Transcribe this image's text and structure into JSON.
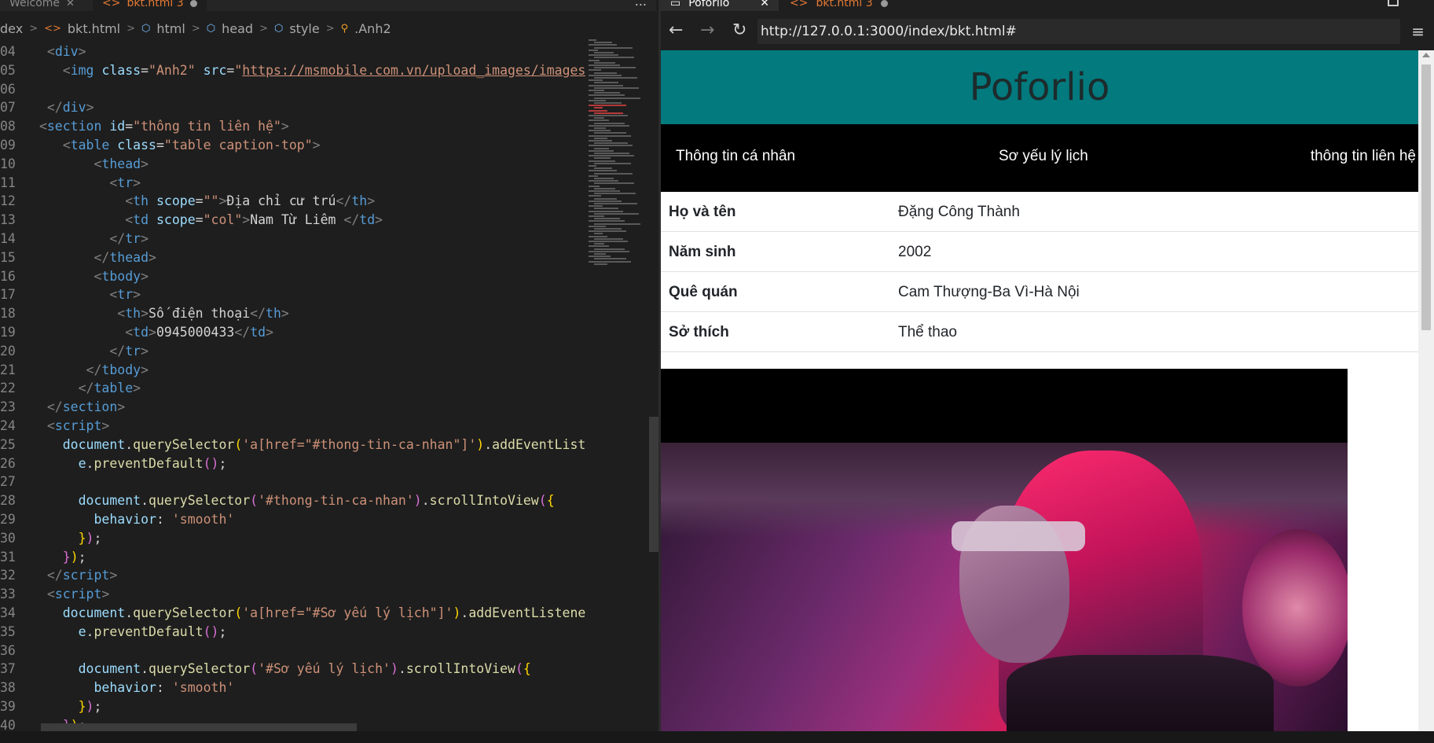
{
  "editor": {
    "tabs": [
      {
        "label": "Welcome",
        "active": false
      },
      {
        "label": "bkt.html 3",
        "active": true
      }
    ],
    "more_label": "...",
    "breadcrumb": [
      "dex",
      "bkt.html",
      "html",
      "head",
      "style",
      ".Anh2"
    ]
  },
  "code_lines": [
    {
      "n": "04",
      "html": "  <span class='t-br'>&lt;</span><span class='t-tag'>div</span><span class='t-br'>&gt;</span>"
    },
    {
      "n": "05",
      "html": "    <span class='t-br'>&lt;</span><span class='t-tag'>img</span> <span class='t-attr'>class</span>=<span class='t-str'>\"Anh2\"</span> <span class='t-attr'>src</span>=<span class='t-str'>\"</span><span class='t-url'>https://msmobile.com.vn/upload_images/images/</span>"
    },
    {
      "n": "06",
      "html": ""
    },
    {
      "n": "07",
      "html": "  <span class='t-br'>&lt;/</span><span class='t-tag'>div</span><span class='t-br'>&gt;</span>"
    },
    {
      "n": "08",
      "html": " <span class='t-br'>&lt;</span><span class='t-tag'>section</span> <span class='t-attr'>id</span>=<span class='t-str'>\"thông tin liên hệ\"</span><span class='t-br'>&gt;</span>"
    },
    {
      "n": "09",
      "html": "    <span class='t-br'>&lt;</span><span class='t-tag'>table</span> <span class='t-attr'>class</span>=<span class='t-str'>\"table caption-top\"</span><span class='t-br'>&gt;</span>"
    },
    {
      "n": "10",
      "html": "        <span class='t-br'>&lt;</span><span class='t-tag'>thead</span><span class='t-br'>&gt;</span>"
    },
    {
      "n": "11",
      "html": "          <span class='t-br'>&lt;</span><span class='t-tag'>tr</span><span class='t-br'>&gt;</span>"
    },
    {
      "n": "12",
      "html": "            <span class='t-br'>&lt;</span><span class='t-tag'>th</span> <span class='t-attr'>scope</span>=<span class='t-str'>\"\"</span><span class='t-br'>&gt;</span><span class='t-txt'>Địa chỉ cư trú</span><span class='t-br'>&lt;/</span><span class='t-tag'>th</span><span class='t-br'>&gt;</span>"
    },
    {
      "n": "13",
      "html": "            <span class='t-br'>&lt;</span><span class='t-tag'>td</span> <span class='t-attr'>scope</span>=<span class='t-str'>\"col\"</span><span class='t-br'>&gt;</span><span class='t-txt'>Nam Từ Liêm </span><span class='t-br'>&lt;/</span><span class='t-tag'>td</span><span class='t-br'>&gt;</span>"
    },
    {
      "n": "14",
      "html": "          <span class='t-br'>&lt;/</span><span class='t-tag'>tr</span><span class='t-br'>&gt;</span>"
    },
    {
      "n": "15",
      "html": "        <span class='t-br'>&lt;/</span><span class='t-tag'>thead</span><span class='t-br'>&gt;</span>"
    },
    {
      "n": "16",
      "html": "        <span class='t-br'>&lt;</span><span class='t-tag'>tbody</span><span class='t-br'>&gt;</span>"
    },
    {
      "n": "17",
      "html": "          <span class='t-br'>&lt;</span><span class='t-tag'>tr</span><span class='t-br'>&gt;</span>"
    },
    {
      "n": "18",
      "html": "           <span class='t-br'>&lt;</span><span class='t-tag'>th</span><span class='t-br'>&gt;</span><span class='t-txt'>Số điện thoại</span><span class='t-br'>&lt;/</span><span class='t-tag'>th</span><span class='t-br'>&gt;</span>"
    },
    {
      "n": "19",
      "html": "            <span class='t-br'>&lt;</span><span class='t-tag'>td</span><span class='t-br'>&gt;</span><span class='t-txt'>0945000433</span><span class='t-br'>&lt;/</span><span class='t-tag'>td</span><span class='t-br'>&gt;</span>"
    },
    {
      "n": "20",
      "html": "          <span class='t-br'>&lt;/</span><span class='t-tag'>tr</span><span class='t-br'>&gt;</span>"
    },
    {
      "n": "21",
      "html": "       <span class='t-br'>&lt;/</span><span class='t-tag'>tbody</span><span class='t-br'>&gt;</span>"
    },
    {
      "n": "22",
      "html": "      <span class='t-br'>&lt;/</span><span class='t-tag'>table</span><span class='t-br'>&gt;</span>"
    },
    {
      "n": "23",
      "html": "  <span class='t-br'>&lt;/</span><span class='t-tag'>section</span><span class='t-br'>&gt;</span>"
    },
    {
      "n": "24",
      "html": "  <span class='t-br'>&lt;</span><span class='t-tag'>script</span><span class='t-br'>&gt;</span>"
    },
    {
      "n": "25",
      "html": "    <span class='t-var'>document</span>.<span class='t-fn'>querySelector</span><span class='t-y'>(</span><span class='t-str'>'a[href=\"#thong-tin-ca-nhan\"]'</span><span class='t-y'>)</span>.<span class='t-fn'>addEventListe</span>"
    },
    {
      "n": "26",
      "html": "      <span class='t-var'>e</span>.<span class='t-fn'>preventDefault</span><span class='t-p'>()</span>;"
    },
    {
      "n": "27",
      "html": ""
    },
    {
      "n": "28",
      "html": "      <span class='t-var'>document</span>.<span class='t-fn'>querySelector</span><span class='t-p'>(</span><span class='t-str'>'#thong-tin-ca-nhan'</span><span class='t-p'>)</span>.<span class='t-fn'>scrollIntoView</span><span class='t-p'>(</span><span class='t-y'>{</span>"
    },
    {
      "n": "29",
      "html": "        <span class='t-var'>behavior</span>: <span class='t-str'>'smooth'</span>"
    },
    {
      "n": "30",
      "html": "      <span class='t-y'>}</span><span class='t-p'>)</span>;"
    },
    {
      "n": "31",
      "html": "    <span class='t-p'>}</span><span class='t-y'>)</span>;"
    },
    {
      "n": "32",
      "html": "  <span class='t-br'>&lt;/</span><span class='t-tag'>script</span><span class='t-br'>&gt;</span>"
    },
    {
      "n": "33",
      "html": "  <span class='t-br'>&lt;</span><span class='t-tag'>script</span><span class='t-br'>&gt;</span>"
    },
    {
      "n": "34",
      "html": "    <span class='t-var'>document</span>.<span class='t-fn'>querySelector</span><span class='t-y'>(</span><span class='t-str'>'a[href=\"#Sơ yếu lý lịch\"]'</span><span class='t-y'>)</span>.<span class='t-fn'>addEventListener</span>"
    },
    {
      "n": "35",
      "html": "      <span class='t-var'>e</span>.<span class='t-fn'>preventDefault</span><span class='t-p'>()</span>;"
    },
    {
      "n": "36",
      "html": ""
    },
    {
      "n": "37",
      "html": "      <span class='t-var'>document</span>.<span class='t-fn'>querySelector</span><span class='t-p'>(</span><span class='t-str'>'#Sơ yếu lý lịch'</span><span class='t-p'>)</span>.<span class='t-fn'>scrollIntoView</span><span class='t-p'>(</span><span class='t-y'>{</span>"
    },
    {
      "n": "38",
      "html": "        <span class='t-var'>behavior</span>: <span class='t-str'>'smooth'</span>"
    },
    {
      "n": "39",
      "html": "      <span class='t-y'>}</span><span class='t-p'>)</span>;"
    },
    {
      "n": "40",
      "html": "    <span class='t-p'>}</span><span class='t-y'>)</span>;"
    }
  ],
  "browser": {
    "tabs": [
      {
        "label": "Poforlio",
        "active": true
      },
      {
        "label": "bkt.html 3",
        "active": false
      }
    ],
    "address": "http://127.0.0.1:3000/index/bkt.html#",
    "page": {
      "title": "Poforlio",
      "nav": [
        "Thông tin cá nhân",
        "Sơ yếu lý lịch",
        "thông tin liên hệ"
      ],
      "info": [
        {
          "label": "Họ và tên",
          "value": "Đặng Công Thành"
        },
        {
          "label": "Năm sinh",
          "value": "2002"
        },
        {
          "label": "Quê quán",
          "value": "Cam Thượng-Ba Vì-Hà Nội"
        },
        {
          "label": "Sở thích",
          "value": "Thể thao"
        }
      ]
    }
  },
  "colors": {
    "hero_bg": "#027a7e",
    "nav_bg": "#000000",
    "editor_bg": "#1e1e1e"
  }
}
